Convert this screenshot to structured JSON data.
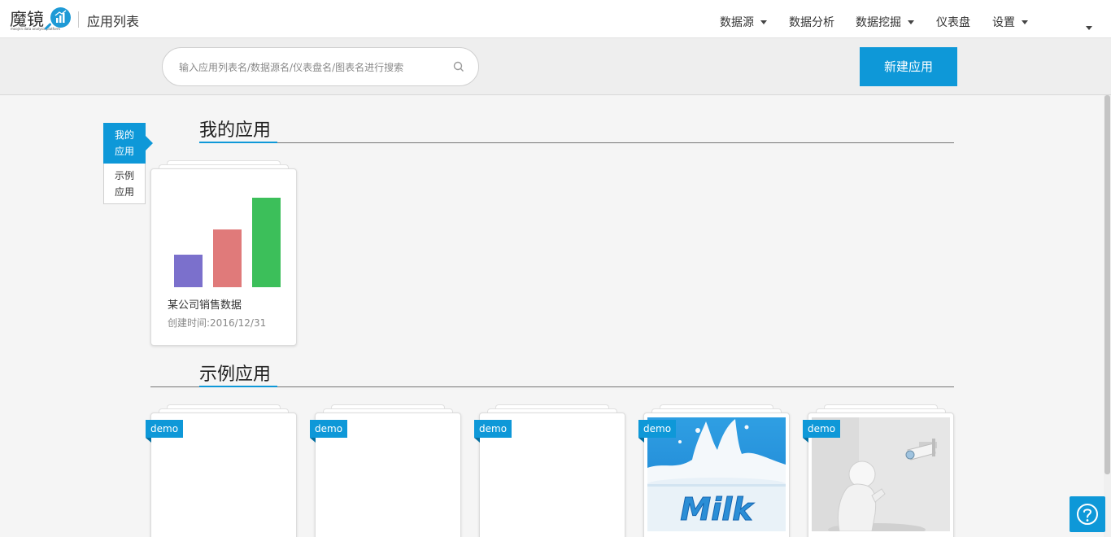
{
  "header": {
    "logo_text": "魔镜",
    "logo_subtext": "moojnn data analysis platform",
    "page_title": "应用列表",
    "nav": [
      {
        "label": "数据源",
        "has_dropdown": true
      },
      {
        "label": "数据分析",
        "has_dropdown": false
      },
      {
        "label": "数据挖掘",
        "has_dropdown": true
      },
      {
        "label": "仪表盘",
        "has_dropdown": false
      },
      {
        "label": "设置",
        "has_dropdown": true
      }
    ]
  },
  "toolbar": {
    "search_placeholder": "输入应用列表名/数据源名/仪表盘名/图表名进行搜索",
    "search_value": "",
    "new_app_label": "新建应用"
  },
  "sidebar": {
    "tabs": [
      {
        "label_line1": "我的",
        "label_line2": "应用",
        "active": true
      },
      {
        "label_line1": "示例",
        "label_line2": "应用",
        "active": false
      }
    ]
  },
  "sections": {
    "my_apps_title": "我的应用",
    "demo_apps_title": "示例应用"
  },
  "my_apps": [
    {
      "name": "某公司销售数据",
      "created": "创建时间:2016/12/31",
      "thumbnail_bars": [
        {
          "value": 40,
          "color": "#7b70cc"
        },
        {
          "value": 70,
          "color": "#e07a7a"
        },
        {
          "value": 109,
          "color": "#3cbf5a"
        }
      ]
    }
  ],
  "demo_apps": [
    {
      "tag": "demo",
      "thumbnail": "blank"
    },
    {
      "tag": "demo",
      "thumbnail": "blank"
    },
    {
      "tag": "demo",
      "thumbnail": "blank"
    },
    {
      "tag": "demo",
      "thumbnail": "milk-splash",
      "thumbnail_text": "Milk"
    },
    {
      "tag": "demo",
      "thumbnail": "figure-with-security-camera"
    }
  ],
  "colors": {
    "accent": "#0e98d8",
    "header_bg": "#ffffff",
    "toolbar_bg": "#eeeeee",
    "page_bg": "#f5f5f5"
  },
  "icons": {
    "search": "search-icon",
    "help": "question-icon",
    "dropdown": "caret-down-icon"
  }
}
